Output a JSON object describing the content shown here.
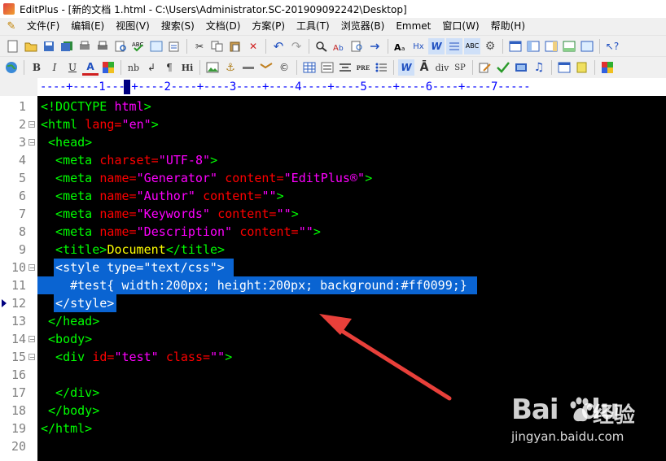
{
  "window": {
    "title": "EditPlus - [新的文档 1.html - C:\\Users\\Administrator.SC-201909092242\\Desktop]"
  },
  "menu": [
    "文件(F)",
    "编辑(E)",
    "视图(V)",
    "搜索(S)",
    "文档(D)",
    "方案(P)",
    "工具(T)",
    "浏览器(B)",
    "Emmet",
    "窗口(W)",
    "帮助(H)"
  ],
  "toolbar2_labels": {
    "bold": "B",
    "italic": "I",
    "underline": "U",
    "font": "A",
    "nbsp": "nb",
    "br": "↲",
    "para": "¶",
    "heading": "Hi",
    "pre": "PRE",
    "div": "div",
    "span": "SP",
    "copyright": "©",
    "anchor": "⚓"
  },
  "ruler": {
    "text": "----+----1----+----2----+----3----+----4----+----5----+----6----+----7-----"
  },
  "code_lines": [
    {
      "n": "1",
      "fold": "",
      "tokens": [
        {
          "t": "<!DOCTYPE ",
          "c": "#00ff00"
        },
        {
          "t": "html",
          "c": "#ff00ff"
        },
        {
          "t": ">",
          "c": "#00ff00"
        }
      ]
    },
    {
      "n": "2",
      "fold": "⊟",
      "tokens": [
        {
          "t": "<html ",
          "c": "#00ff00"
        },
        {
          "t": "lang=",
          "c": "#ff0000"
        },
        {
          "t": "\"en\"",
          "c": "#ff00ff"
        },
        {
          "t": ">",
          "c": "#00ff00"
        }
      ]
    },
    {
      "n": "3",
      "fold": "⊟",
      "tokens": [
        {
          "t": " <head>",
          "c": "#00ff00"
        }
      ]
    },
    {
      "n": "4",
      "fold": "",
      "tokens": [
        {
          "t": "  <meta ",
          "c": "#00ff00"
        },
        {
          "t": "charset=",
          "c": "#ff0000"
        },
        {
          "t": "\"UTF-8\"",
          "c": "#ff00ff"
        },
        {
          "t": ">",
          "c": "#00ff00"
        }
      ]
    },
    {
      "n": "5",
      "fold": "",
      "tokens": [
        {
          "t": "  <meta ",
          "c": "#00ff00"
        },
        {
          "t": "name=",
          "c": "#ff0000"
        },
        {
          "t": "\"Generator\" ",
          "c": "#ff00ff"
        },
        {
          "t": "content=",
          "c": "#ff0000"
        },
        {
          "t": "\"EditPlus®\"",
          "c": "#ff00ff"
        },
        {
          "t": ">",
          "c": "#00ff00"
        }
      ]
    },
    {
      "n": "6",
      "fold": "",
      "tokens": [
        {
          "t": "  <meta ",
          "c": "#00ff00"
        },
        {
          "t": "name=",
          "c": "#ff0000"
        },
        {
          "t": "\"Author\" ",
          "c": "#ff00ff"
        },
        {
          "t": "content=",
          "c": "#ff0000"
        },
        {
          "t": "\"\"",
          "c": "#ff00ff"
        },
        {
          "t": ">",
          "c": "#00ff00"
        }
      ]
    },
    {
      "n": "7",
      "fold": "",
      "tokens": [
        {
          "t": "  <meta ",
          "c": "#00ff00"
        },
        {
          "t": "name=",
          "c": "#ff0000"
        },
        {
          "t": "\"Keywords\" ",
          "c": "#ff00ff"
        },
        {
          "t": "content=",
          "c": "#ff0000"
        },
        {
          "t": "\"\"",
          "c": "#ff00ff"
        },
        {
          "t": ">",
          "c": "#00ff00"
        }
      ]
    },
    {
      "n": "8",
      "fold": "",
      "tokens": [
        {
          "t": "  <meta ",
          "c": "#00ff00"
        },
        {
          "t": "name=",
          "c": "#ff0000"
        },
        {
          "t": "\"Description\" ",
          "c": "#ff00ff"
        },
        {
          "t": "content=",
          "c": "#ff0000"
        },
        {
          "t": "\"\"",
          "c": "#ff00ff"
        },
        {
          "t": ">",
          "c": "#00ff00"
        }
      ]
    },
    {
      "n": "9",
      "fold": "",
      "tokens": [
        {
          "t": "  <title>",
          "c": "#00ff00"
        },
        {
          "t": "Document",
          "c": "#ffff00"
        },
        {
          "t": "</title>",
          "c": "#00ff00"
        }
      ]
    },
    {
      "n": "10",
      "fold": "⊟",
      "sel": true,
      "tokens": [
        {
          "t": "  <style type=\"text/css\"> ",
          "c": "#ffffff"
        }
      ]
    },
    {
      "n": "11",
      "fold": "",
      "sel": true,
      "tokens": [
        {
          "t": "    #test{ width:200px; height:200px; background:#ff0099;} ",
          "c": "#ffffff"
        }
      ]
    },
    {
      "n": "12",
      "fold": "",
      "sel": true,
      "marker": true,
      "tokens": [
        {
          "t": "  </style>",
          "c": "#ffffff"
        }
      ]
    },
    {
      "n": "13",
      "fold": "",
      "tokens": [
        {
          "t": " </head>",
          "c": "#00ff00"
        }
      ]
    },
    {
      "n": "14",
      "fold": "⊟",
      "tokens": [
        {
          "t": " <body>",
          "c": "#00ff00"
        }
      ]
    },
    {
      "n": "15",
      "fold": "⊟",
      "tokens": [
        {
          "t": "  <div ",
          "c": "#00ff00"
        },
        {
          "t": "id=",
          "c": "#ff0000"
        },
        {
          "t": "\"test\" ",
          "c": "#ff00ff"
        },
        {
          "t": "class=",
          "c": "#ff0000"
        },
        {
          "t": "\"\"",
          "c": "#ff00ff"
        },
        {
          "t": ">",
          "c": "#00ff00"
        }
      ]
    },
    {
      "n": "16",
      "fold": "",
      "tokens": []
    },
    {
      "n": "17",
      "fold": "",
      "tokens": [
        {
          "t": "  </div>",
          "c": "#00ff00"
        }
      ]
    },
    {
      "n": "18",
      "fold": "",
      "tokens": [
        {
          "t": " </body>",
          "c": "#00ff00"
        }
      ]
    },
    {
      "n": "19",
      "fold": "",
      "tokens": [
        {
          "t": "</html>",
          "c": "#00ff00"
        }
      ]
    },
    {
      "n": "20",
      "fold": "",
      "tokens": []
    }
  ],
  "watermark": {
    "logo": "Bai",
    "logo2": "du",
    "cn": "经验",
    "url": "jingyan.baidu.com"
  },
  "colors": {
    "selection": "#0a64d2",
    "editor_bg": "#000000",
    "arrow": "#e8403a"
  }
}
